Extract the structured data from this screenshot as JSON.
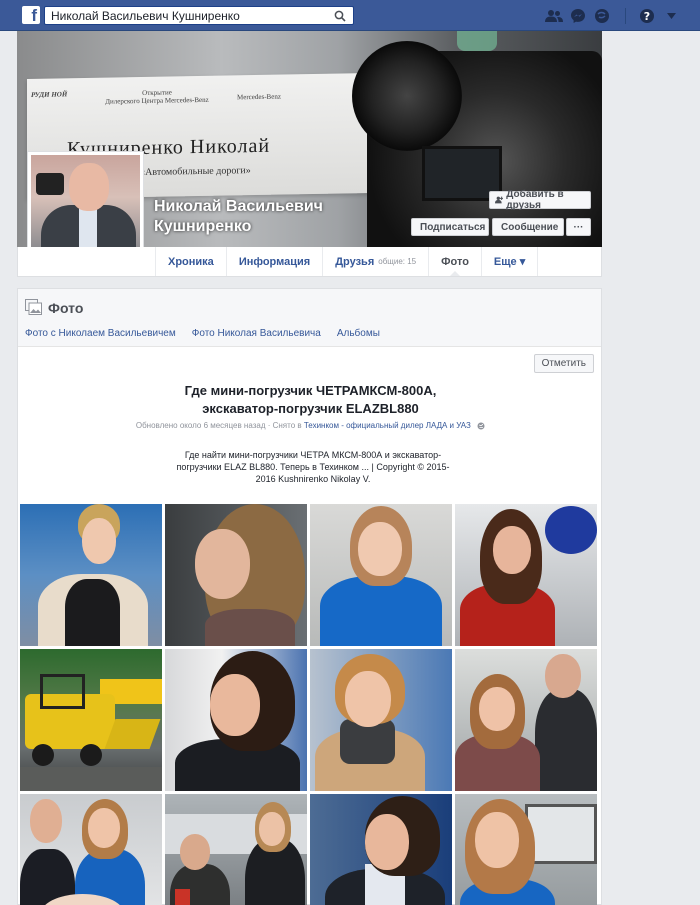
{
  "topbar": {
    "logo": "f",
    "search_value": "Николай Васильевич Кушниренко",
    "icons": [
      "search-icon",
      "friend-requests-icon",
      "messages-icon",
      "notifications-icon",
      "help-icon",
      "chevron-down-icon"
    ]
  },
  "cover": {
    "sign_small_left": "Открытие\nДилерского Центра Mercedes-Benz",
    "sign_small_right": "Mercedes-Benz",
    "sign_brand": "РУДИ НОЙ",
    "sign_name": "Кушниренко Николай",
    "sign_sub": "Издание «Автомобильные дороги»",
    "profile_name": "Николай Васильевич Кушниренко",
    "add_friend": "Добавить в друзья",
    "subscribe": "Подписаться",
    "message": "Сообщение",
    "more": "···"
  },
  "tabs": [
    {
      "label": "Хроника"
    },
    {
      "label": "Информация"
    },
    {
      "label": "Друзья",
      "count": "общие: 15"
    },
    {
      "label": "Фото"
    },
    {
      "label": "Еще ▾"
    }
  ],
  "photos": {
    "title": "Фото",
    "sublinks": [
      "Фото с Николаем Васильевичем",
      "Фото Николая Васильевича",
      "Альбомы"
    ],
    "mark_button": "Отметить",
    "album_title_line1": "Где мини-погрузчик ЧЕТРАМКСМ-800А,",
    "album_title_line2": "экскаватор-погрузчик ELAZBL880",
    "meta_prefix": "Обновлено около 6 месяцев назад · Снято в ",
    "meta_link": "Техинком - официальный дилер ЛАДА и УАЗ",
    "description": "Где найти мини-погрузчики ЧЕТРА МКСМ-800А и экскаватор-погрузчики ELAZ BL880. Теперь в Техинком ... | Copyright © 2015-2016 Kushnirenko Nikolay V."
  },
  "colors": {
    "brand_blue": "#3b5998",
    "link_blue": "#365899",
    "page_bg": "#e9ebee"
  }
}
